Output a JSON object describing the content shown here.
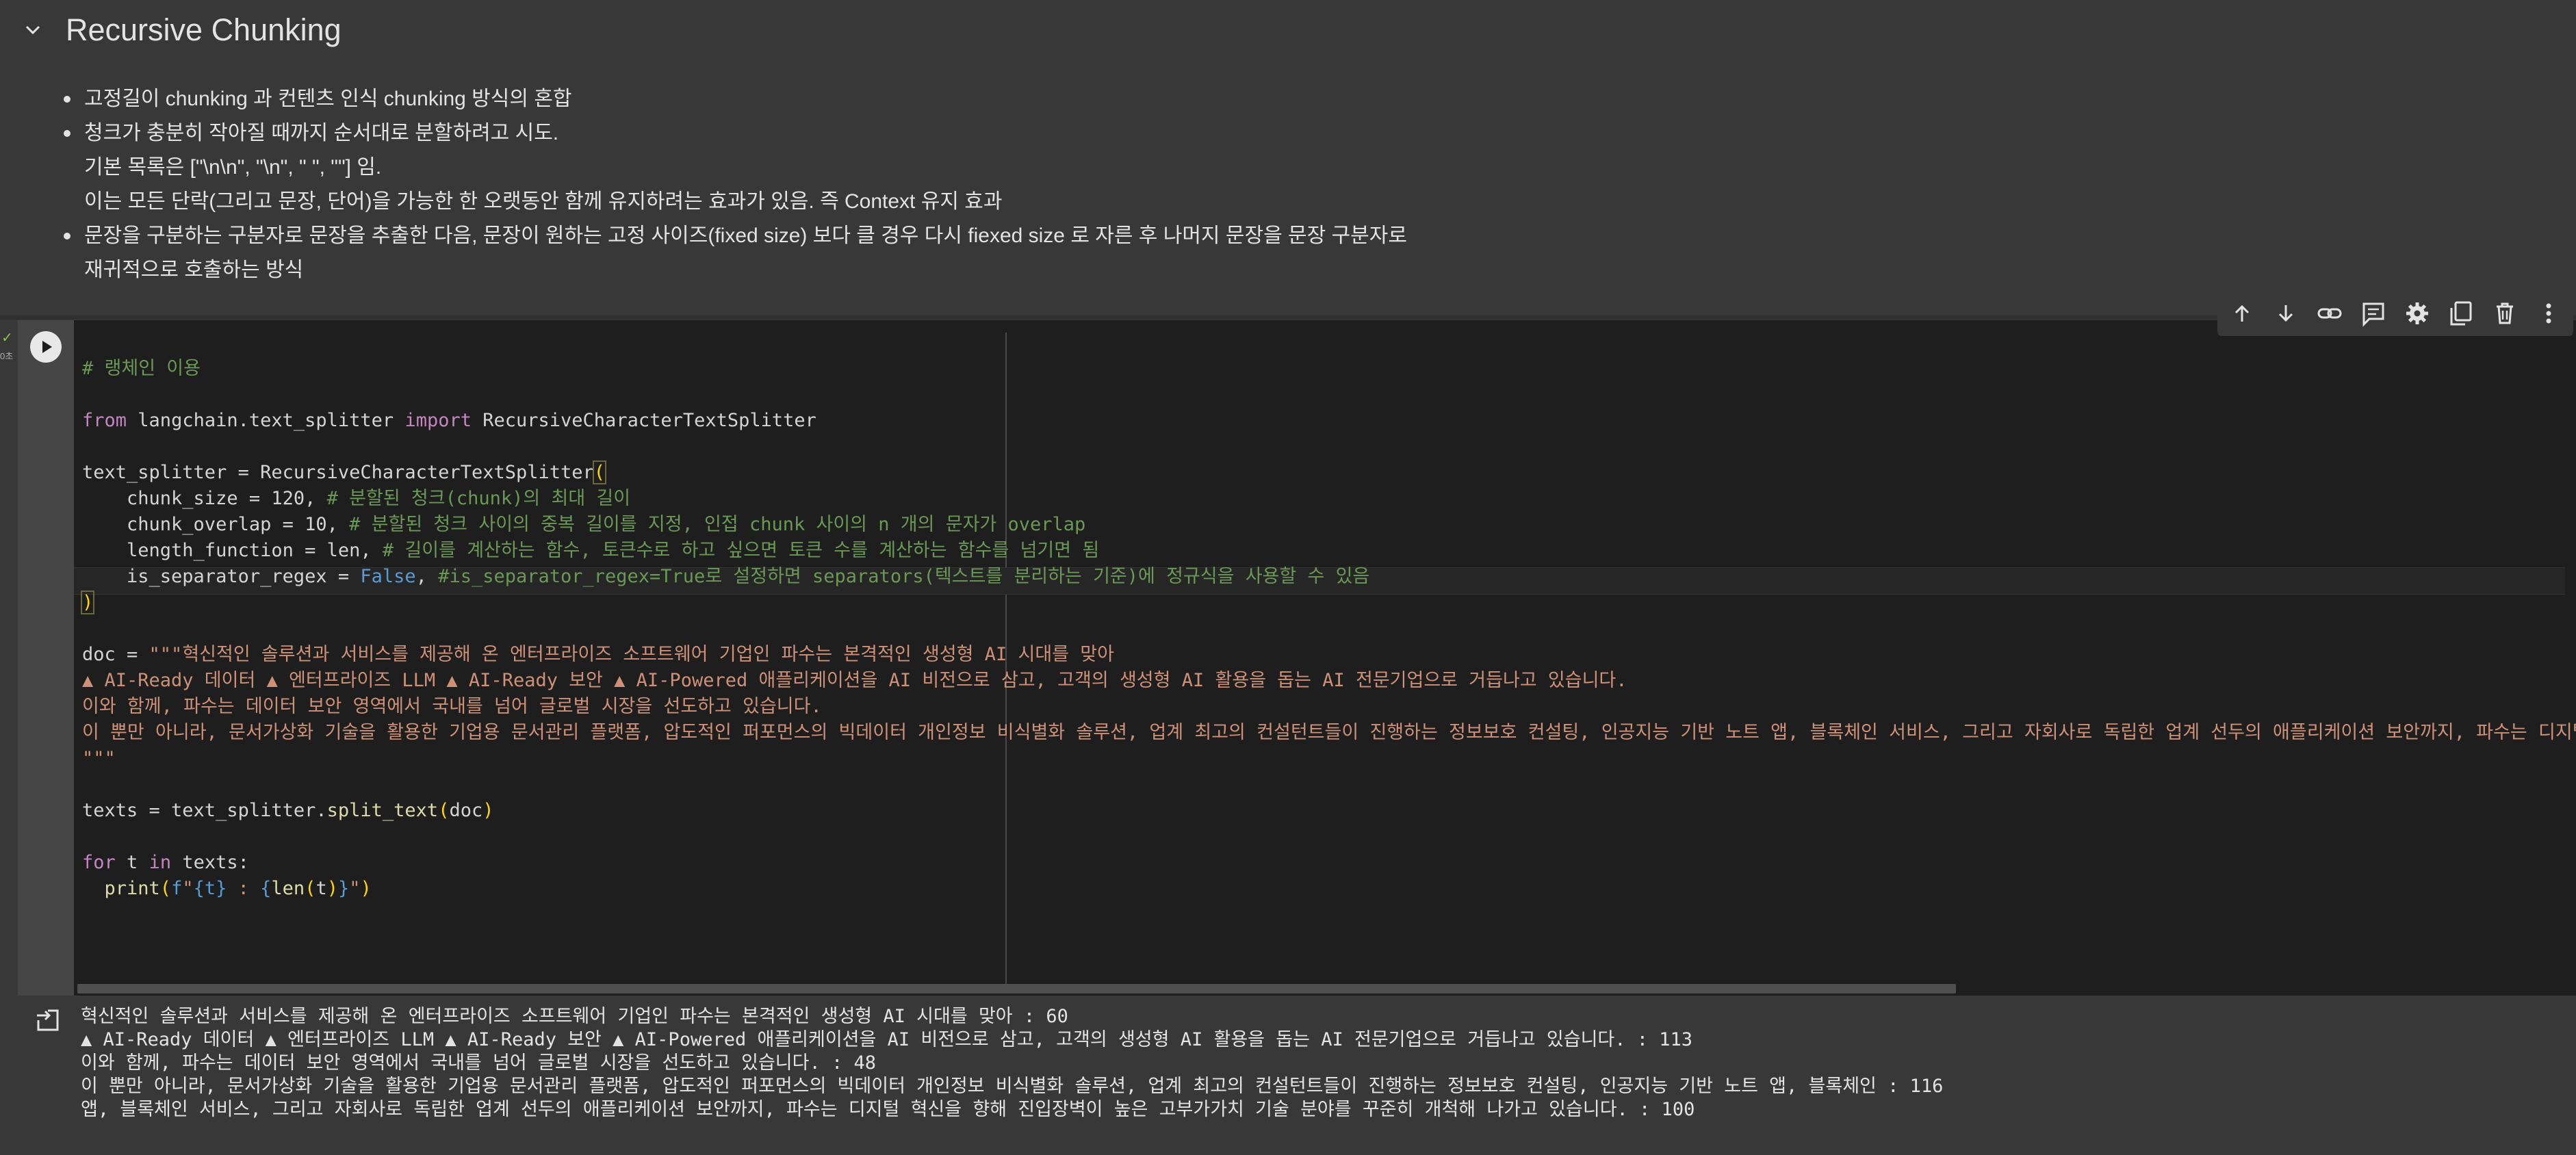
{
  "section": {
    "title": "Recursive Chunking",
    "bullets": [
      "고정길이 chunking 과 컨텐츠 인식 chunking 방식의 혼합",
      "청크가 충분히 작아질 때까지 순서대로 분할하려고 시도.",
      "기본 목록은 [\"\\n\\n\", \"\\n\", \" \", \"\"] 임.",
      "이는 모든 단락(그리고 문장, 단어)을 가능한 한 오랫동안 함께 유지하려는 효과가 있음. 즉 Context 유지 효과",
      "문장을 구분하는 구분자로 문장을 추출한 다음, 문장이 원하는 고정 사이즈(fixed size) 보다 클 경우 다시 fiexed size 로 자른 후 나머지 문장을 문장 구분자로",
      "재귀적으로 호출하는 방식"
    ]
  },
  "cell": {
    "status_check": "✓",
    "elapsed": "0초"
  },
  "code": {
    "comment_header": "# 랭체인 이용",
    "kw_from": "from",
    "module": "langchain.text_splitter",
    "kw_import": "import",
    "class_name": "RecursiveCharacterTextSplitter",
    "assign_splitter": "text_splitter = ",
    "open_paren": "(",
    "close_paren": ")",
    "arg1": "    chunk_size = 120, ",
    "arg1_comment": "# 분할된 청크(chunk)의 최대 길이",
    "arg2": "    chunk_overlap = 10, ",
    "arg2_comment": "# 분할된 청크 사이의 중복 길이를 지정, 인접 chunk 사이의 n 개의 문자가 overlap",
    "arg3": "    length_function = len, ",
    "arg3_comment": "# 길이를 계산하는 함수, 토큰수로 하고 싶으면 토큰 수를 계산하는 함수를 넘기면 됨",
    "arg4": "    is_separator_regex = ",
    "false_kw": "False",
    "arg4_sep": ", ",
    "arg4_comment": "#is_separator_regex=True로 설정하면 separators(텍스트를 분리하는 기준)에 정규식을 사용할 수 있음",
    "doc_assign": "doc = ",
    "doc_line1": "\"\"\"혁신적인 솔루션과 서비스를 제공해 온 엔터프라이즈 소프트웨어 기업인 파수는 본격적인 생성형 AI 시대를 맞아",
    "doc_line2": "▲ AI-Ready 데이터 ▲ 엔터프라이즈 LLM ▲ AI-Ready 보안 ▲ AI-Powered 애플리케이션을 AI 비전으로 삼고, 고객의 생성형 AI 활용을 돕는 AI 전문기업으로 거듭나고 있습니다.",
    "doc_line3": "이와 함께, 파수는 데이터 보안 영역에서 국내를 넘어 글로벌 시장을 선도하고 있습니다.",
    "doc_line4": "이 뿐만 아니라, 문서가상화 기술을 활용한 기업용 문서관리 플랫폼, 압도적인 퍼포먼스의 빅데이터 개인정보 비식별화 솔루션, 업계 최고의 컨설턴트들이 진행하는 정보보호 컨설팅, 인공지능 기반 노트 앱, 블록체인 서비스, 그리고 자회사로 독립한 업계 선두의 애플리케이션 보안까지, 파수는 디지털",
    "doc_close": "\"\"\"",
    "texts_assign": "texts = text_splitter.",
    "split_fn": "split_text",
    "split_arg": "doc",
    "kw_for": "for",
    "loop_var": " t ",
    "kw_in": "in",
    "loop_iter": " texts:",
    "print_indent": "  ",
    "print_fn": "print",
    "fstring_prefix": "f",
    "fstring_q": "\"",
    "fs_expr_t": "{t}",
    "fs_mid": " : ",
    "fs_open": "{",
    "len_fn": "len",
    "len_arg": "t",
    "fs_close": "}"
  },
  "output": {
    "lines": [
      "혁신적인 솔루션과 서비스를 제공해 온 엔터프라이즈 소프트웨어 기업인 파수는 본격적인 생성형 AI 시대를 맞아 : 60",
      "▲ AI-Ready 데이터 ▲ 엔터프라이즈 LLM ▲ AI-Ready 보안 ▲ AI-Powered 애플리케이션을 AI 비전으로 삼고, 고객의 생성형 AI 활용을 돕는 AI 전문기업으로 거듭나고 있습니다. : 113",
      "이와 함께, 파수는 데이터 보안 영역에서 국내를 넘어 글로벌 시장을 선도하고 있습니다. : 48",
      "이 뿐만 아니라, 문서가상화 기술을 활용한 기업용 문서관리 플랫폼, 압도적인 퍼포먼스의 빅데이터 개인정보 비식별화 솔루션, 업계 최고의 컨설턴트들이 진행하는 정보보호 컨설팅, 인공지능 기반 노트 앱, 블록체인 : 116",
      "앱, 블록체인 서비스, 그리고 자회사로 독립한 업계 선두의 애플리케이션 보안까지, 파수는 디지털 혁신을 향해 진입장벽이 높은 고부가가치 기술 분야를 꾸준히 개척해 나가고 있습니다. : 100"
    ]
  }
}
